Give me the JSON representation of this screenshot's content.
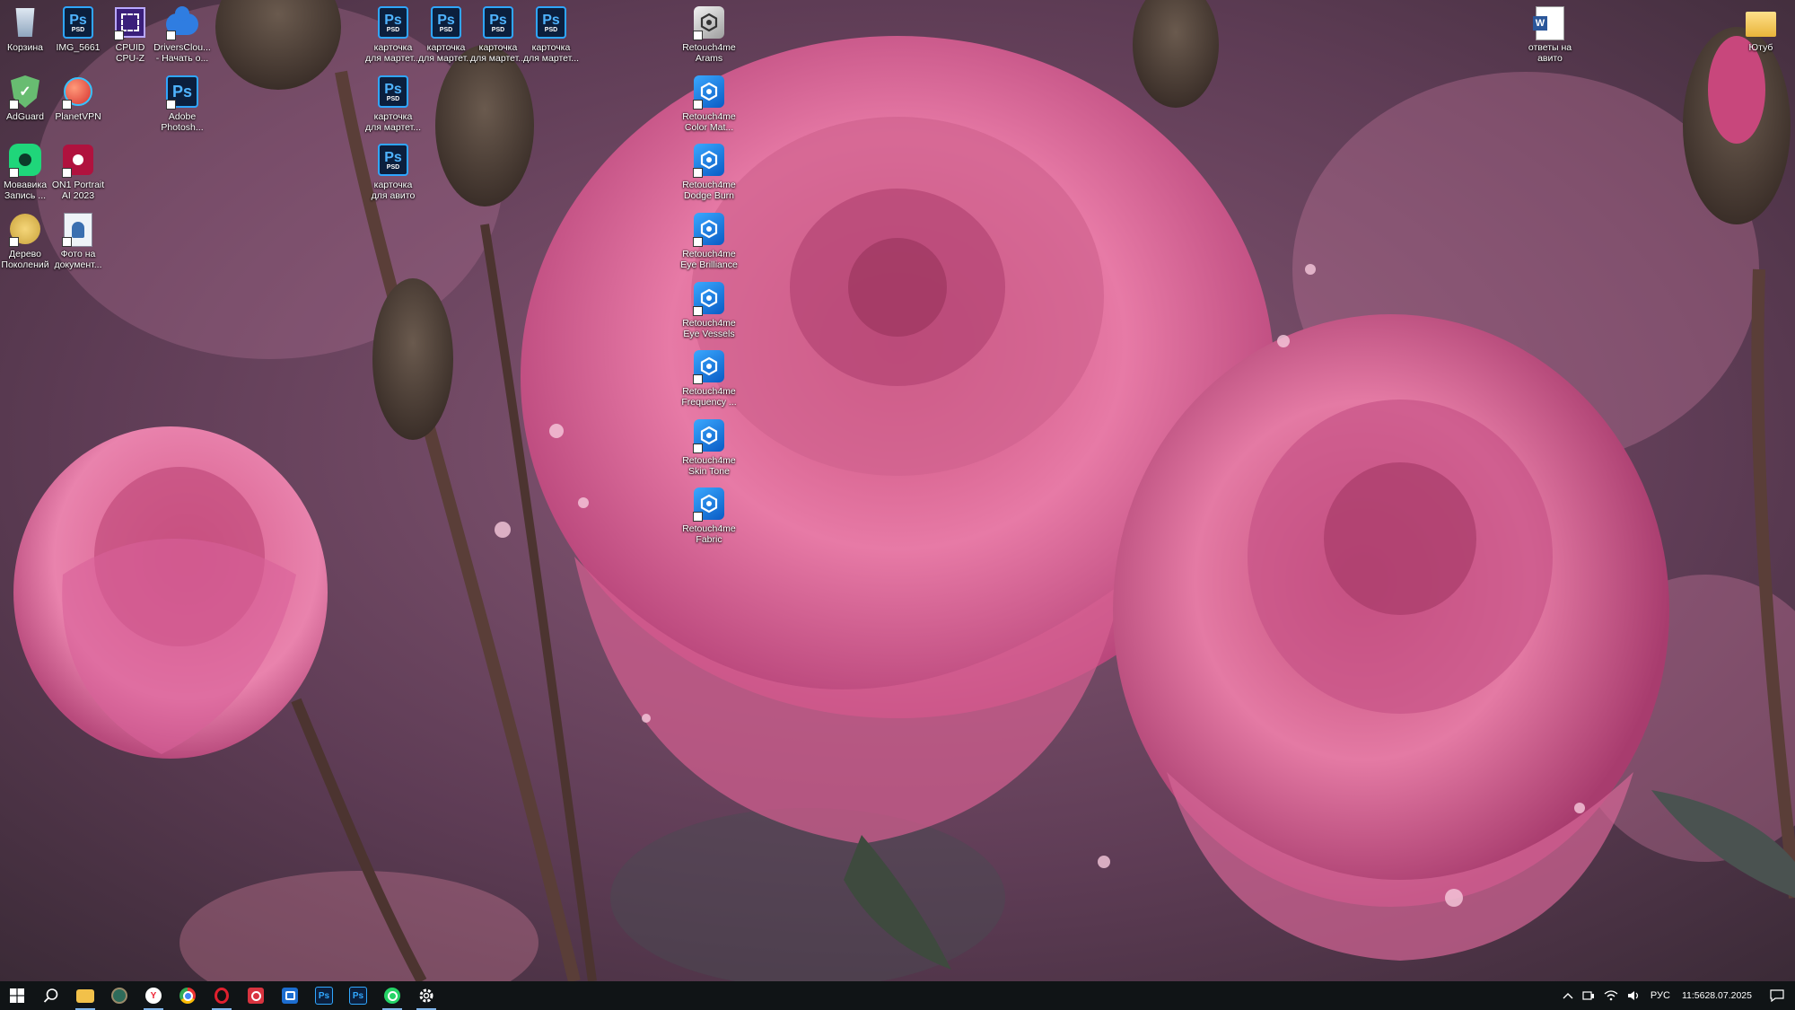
{
  "desktop": {
    "icons": [
      {
        "id": "recycle",
        "label": "Корзина",
        "icon": "recycle-bin-icon"
      },
      {
        "id": "img5661",
        "label": "IMG_5661",
        "icon": "psd-file-icon",
        "badge": "PSD"
      },
      {
        "id": "cpuz",
        "label": "CPUID\nCPU-Z",
        "icon": "cpu-z-icon"
      },
      {
        "id": "drivers",
        "label": "DriversClou...\n- Начать о...",
        "icon": "drivers-cloud-icon"
      },
      {
        "id": "card1",
        "label": "карточка\nдля мартет...",
        "icon": "psd-file-icon",
        "badge": "PSD"
      },
      {
        "id": "card2",
        "label": "карточка\nдля мартет...",
        "icon": "psd-file-icon",
        "badge": "PSD"
      },
      {
        "id": "card3",
        "label": "карточка\nдля мартет...",
        "icon": "psd-file-icon",
        "badge": "PSD"
      },
      {
        "id": "card4",
        "label": "карточка\nдля мартет...",
        "icon": "psd-file-icon",
        "badge": "PSD"
      },
      {
        "id": "adguard",
        "label": "AdGuard",
        "icon": "adguard-icon"
      },
      {
        "id": "planetvpn",
        "label": "PlanetVPN",
        "icon": "planet-vpn-icon"
      },
      {
        "id": "photoshop",
        "label": "Adobe\nPhotosh...",
        "icon": "photoshop-app-icon"
      },
      {
        "id": "card5",
        "label": "карточка\nдля мартет...",
        "icon": "psd-file-icon",
        "badge": "PSD"
      },
      {
        "id": "movavi",
        "label": "Мовавика\nЗапись ...",
        "icon": "movavi-icon"
      },
      {
        "id": "on1",
        "label": "ON1 Portrait\nAI 2023",
        "icon": "on1-portrait-icon"
      },
      {
        "id": "card6",
        "label": "карточка\nдля авито",
        "icon": "psd-file-icon",
        "badge": "PSD"
      },
      {
        "id": "tree",
        "label": "Дерево\nПоколений",
        "icon": "family-tree-icon"
      },
      {
        "id": "photodocs",
        "label": "Фото на\nдокумент...",
        "icon": "photo-documents-icon"
      },
      {
        "id": "r_arams",
        "label": "Retouch4me\nArams",
        "icon": "retouch4me-arams-icon"
      },
      {
        "id": "r_color",
        "label": "Retouch4me\nColor Mat...",
        "icon": "retouch4me-icon"
      },
      {
        "id": "r_dodge",
        "label": "Retouch4me\nDodge Burn",
        "icon": "retouch4me-icon"
      },
      {
        "id": "r_eye",
        "label": "Retouch4me\nEye Brilliance",
        "icon": "retouch4me-icon"
      },
      {
        "id": "r_vessels",
        "label": "Retouch4me\nEye Vessels",
        "icon": "retouch4me-icon"
      },
      {
        "id": "r_freq",
        "label": "Retouch4me\nFrequency ...",
        "icon": "retouch4me-icon"
      },
      {
        "id": "r_skin",
        "label": "Retouch4me\nSkin Tone",
        "icon": "retouch4me-icon"
      },
      {
        "id": "r_fabric",
        "label": "Retouch4me\nFabric",
        "icon": "retouch4me-icon"
      },
      {
        "id": "answers",
        "label": "ответы на\nавито",
        "icon": "word-document-icon"
      },
      {
        "id": "youtube",
        "label": "Ютуб",
        "icon": "folder-icon"
      }
    ]
  },
  "taskbar": {
    "apps": [
      {
        "name": "start-button",
        "icon": "windows-logo-icon"
      },
      {
        "name": "search-button",
        "icon": "search-icon"
      },
      {
        "name": "file-explorer",
        "icon": "folder-icon"
      },
      {
        "name": "app-green",
        "icon": "circle-app-icon"
      },
      {
        "name": "yandex-browser",
        "icon": "yandex-icon",
        "text": "Y"
      },
      {
        "name": "chrome",
        "icon": "chrome-icon"
      },
      {
        "name": "opera",
        "icon": "opera-icon"
      },
      {
        "name": "camera-app",
        "icon": "camera-icon"
      },
      {
        "name": "screenshot-app",
        "icon": "screenshot-icon"
      },
      {
        "name": "photoshop-1",
        "icon": "photoshop-icon",
        "text": "Ps"
      },
      {
        "name": "photoshop-2",
        "icon": "photoshop-icon",
        "text": "Ps"
      },
      {
        "name": "whatsapp",
        "icon": "whatsapp-icon"
      },
      {
        "name": "settings",
        "icon": "gear-icon"
      }
    ],
    "tray": {
      "language": "РУС",
      "time": "11:56",
      "date": "28.07.2025"
    }
  },
  "colors": {
    "taskbar_bg": "#101416",
    "ps_blue": "#2fa6ff",
    "retouch_blue": "#1a7fe6"
  }
}
